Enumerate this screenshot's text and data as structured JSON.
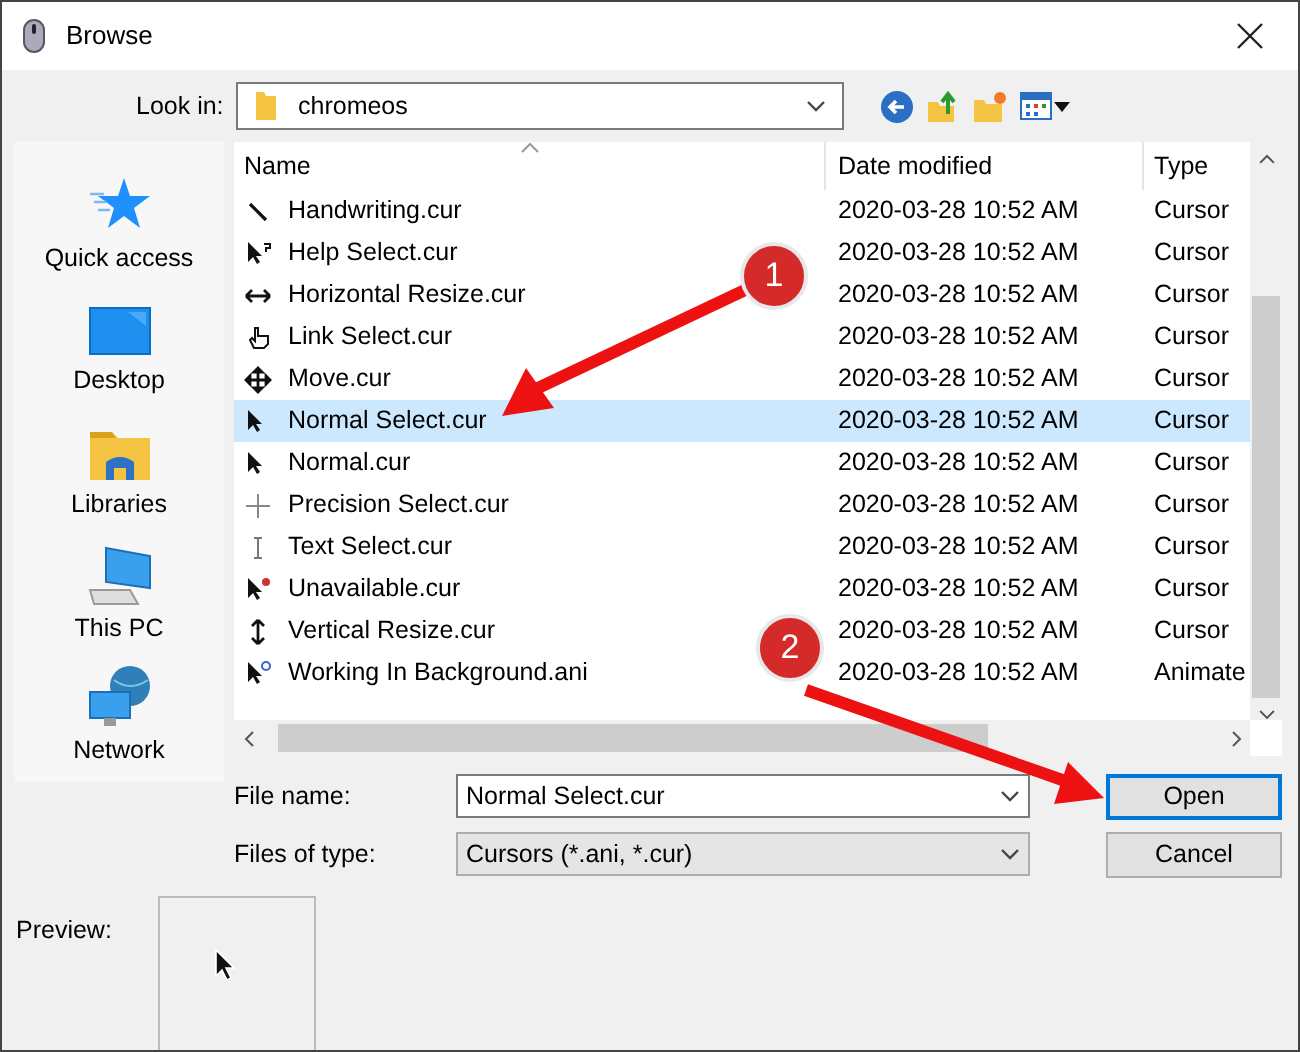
{
  "window": {
    "title": "Browse"
  },
  "look_in": {
    "label": "Look in:",
    "value": "chromeos"
  },
  "places": [
    {
      "label": "Quick access"
    },
    {
      "label": "Desktop"
    },
    {
      "label": "Libraries"
    },
    {
      "label": "This PC"
    },
    {
      "label": "Network"
    }
  ],
  "file_list": {
    "columns": [
      "Name",
      "Date modified",
      "Type"
    ],
    "rows": [
      {
        "name": "Handwriting.cur",
        "date": "2020-03-28 10:52 AM",
        "type": "Cursor",
        "selected": false
      },
      {
        "name": "Help Select.cur",
        "date": "2020-03-28 10:52 AM",
        "type": "Cursor",
        "selected": false
      },
      {
        "name": "Horizontal Resize.cur",
        "date": "2020-03-28 10:52 AM",
        "type": "Cursor",
        "selected": false
      },
      {
        "name": "Link Select.cur",
        "date": "2020-03-28 10:52 AM",
        "type": "Cursor",
        "selected": false
      },
      {
        "name": "Move.cur",
        "date": "2020-03-28 10:52 AM",
        "type": "Cursor",
        "selected": false
      },
      {
        "name": "Normal Select.cur",
        "date": "2020-03-28 10:52 AM",
        "type": "Cursor",
        "selected": true
      },
      {
        "name": "Normal.cur",
        "date": "2020-03-28 10:52 AM",
        "type": "Cursor",
        "selected": false
      },
      {
        "name": "Precision Select.cur",
        "date": "2020-03-28 10:52 AM",
        "type": "Cursor",
        "selected": false
      },
      {
        "name": "Text Select.cur",
        "date": "2020-03-28 10:52 AM",
        "type": "Cursor",
        "selected": false
      },
      {
        "name": "Unavailable.cur",
        "date": "2020-03-28 10:52 AM",
        "type": "Cursor",
        "selected": false
      },
      {
        "name": "Vertical Resize.cur",
        "date": "2020-03-28 10:52 AM",
        "type": "Cursor",
        "selected": false
      },
      {
        "name": "Working In Background.ani",
        "date": "2020-03-28 10:52 AM",
        "type": "Animate",
        "selected": false
      }
    ]
  },
  "file_name": {
    "label": "File name:",
    "value": "Normal Select.cur"
  },
  "file_type": {
    "label": "Files of type:",
    "value": "Cursors (*.ani, *.cur)"
  },
  "buttons": [
    {
      "label": "Open",
      "default": true
    },
    {
      "label": "Cancel",
      "default": false
    }
  ],
  "preview": {
    "label": "Preview:"
  },
  "callouts": [
    "1",
    "2"
  ]
}
